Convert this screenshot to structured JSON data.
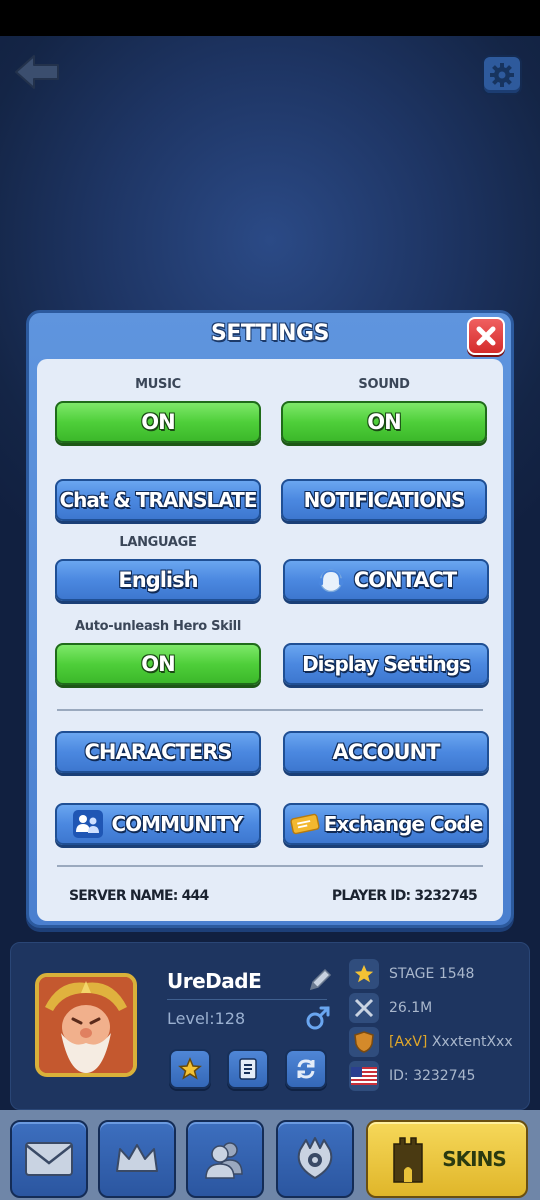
{
  "settings": {
    "title": "SETTINGS",
    "music_label": "MUSIC",
    "music_value": "ON",
    "sound_label": "SOUND",
    "sound_value": "ON",
    "chat_translate": "Chat & TRANSLATE",
    "notifications": "NOTIFICATIONS",
    "language_label": "LANGUAGE",
    "language_value": "English",
    "contact": "CONTACT",
    "auto_unleash_label": "Auto-unleash Hero Skill",
    "auto_unleash_value": "ON",
    "display_settings": "Display Settings",
    "characters": "CHARACTERS",
    "account": "ACCOUNT",
    "community": "COMMUNITY",
    "exchange_code": "Exchange Code",
    "server_name": "SERVER NAME: 444",
    "player_id": "PLAYER ID: 3232745"
  },
  "profile": {
    "name": "UreDadE",
    "level": "Level:128",
    "stage": "STAGE 1548",
    "power": "26.1M",
    "guild_tag": "[AxV]",
    "guild_name": "XxxtentXxx",
    "id": "ID: 3232745"
  },
  "nav": {
    "skins": "SKINS"
  },
  "colors": {
    "green_button": "#4fcf3a",
    "blue_button": "#4b88e0",
    "modal_blue": "#5b90dc",
    "close_red": "#d42b2b",
    "skins_yellow": "#e8c23a"
  },
  "icons": [
    "back-arrow-icon",
    "gear-icon",
    "close-icon",
    "headset-icon",
    "people-icon",
    "ticket-icon",
    "star-icon",
    "document-icon",
    "refresh-icon",
    "pencil-icon",
    "male-icon",
    "crossed-swords-icon",
    "guild-shield-icon",
    "us-flag-icon",
    "mail-icon",
    "crown-icon",
    "friends-icon",
    "monster-icon",
    "castle-icon"
  ]
}
